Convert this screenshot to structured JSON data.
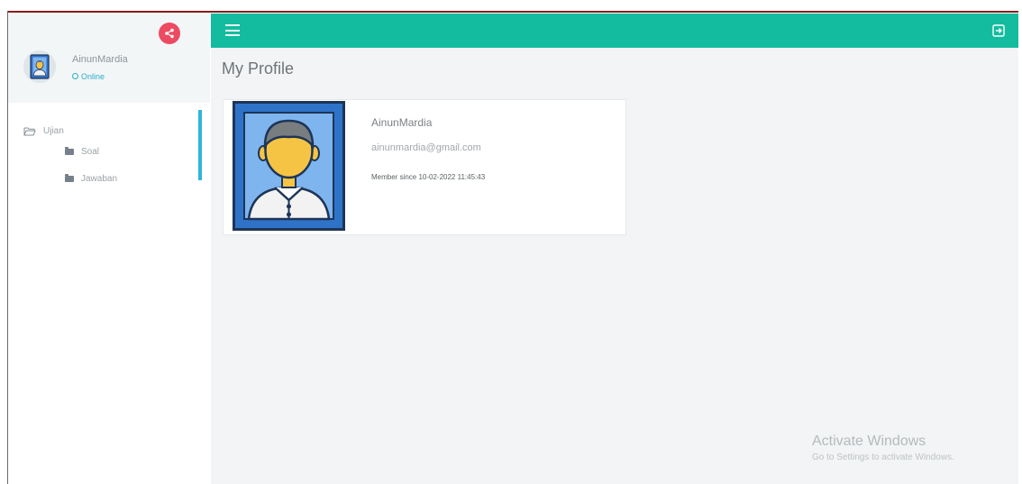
{
  "sidebar": {
    "user_name": "AinunMardia",
    "status": "Online",
    "menu": {
      "group_label": "Ujian",
      "items": [
        {
          "label": "Soal"
        },
        {
          "label": "Jawaban"
        }
      ]
    }
  },
  "header": {
    "menu_icon": "hamburger-icon",
    "logout_icon": "sign-out-icon"
  },
  "main": {
    "page_title": "My Profile",
    "profile": {
      "name": "AinunMardia",
      "email": "ainunmardia@gmail.com",
      "member_since": "Member since 10-02-2022 11:45:43"
    }
  },
  "watermark": {
    "title": "Activate Windows",
    "subtitle": "Go to Settings to activate Windows."
  },
  "colors": {
    "header": "#13bc9e",
    "share_button": "#ec4b61",
    "active_menu_bar": "#2fb6d9",
    "status": "#2aaecb"
  }
}
